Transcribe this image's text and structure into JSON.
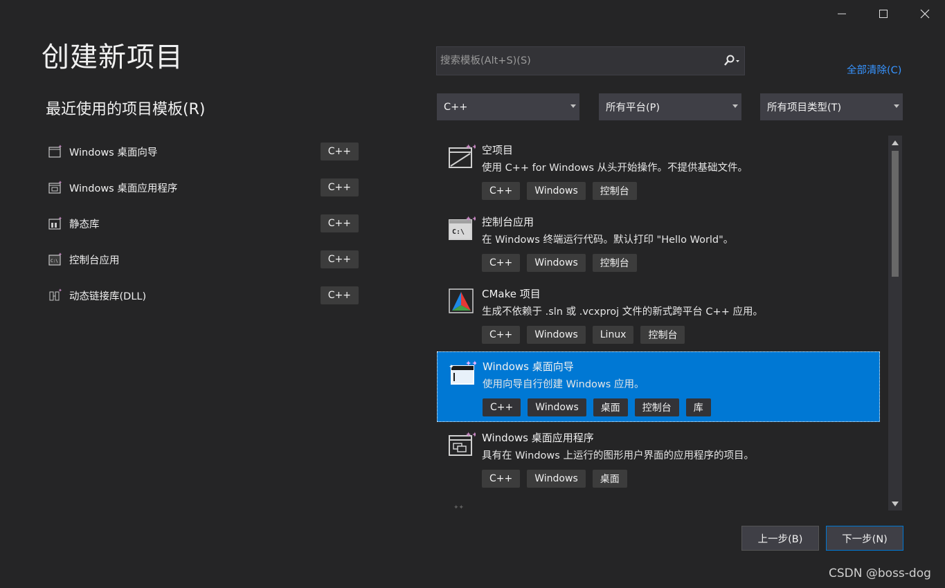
{
  "window_controls": {
    "minimize": "—",
    "maximize": "☐",
    "close": "✕"
  },
  "page": {
    "title": "创建新项目"
  },
  "recent": {
    "title": "最近使用的项目模板(R)",
    "items": [
      {
        "label": "Windows 桌面向导",
        "tag": "C++",
        "icon": "wizard-template-icon"
      },
      {
        "label": "Windows 桌面应用程序",
        "tag": "C++",
        "icon": "desktop-app-template-icon"
      },
      {
        "label": "静态库",
        "tag": "C++",
        "icon": "static-library-template-icon"
      },
      {
        "label": "控制台应用",
        "tag": "C++",
        "icon": "console-app-template-icon"
      },
      {
        "label": "动态链接库(DLL)",
        "tag": "C++",
        "icon": "dll-template-icon"
      }
    ]
  },
  "search": {
    "placeholder": "搜索模板(Alt+S)(S)",
    "value": ""
  },
  "clear_all": "全部清除(C)",
  "filters": {
    "language": "C++",
    "platform": "所有平台(P)",
    "project_type": "所有项目类型(T)"
  },
  "templates": [
    {
      "name": "空项目",
      "desc": "使用 C++ for Windows 从头开始操作。不提供基础文件。",
      "tags": [
        "C++",
        "Windows",
        "控制台"
      ],
      "selected": false,
      "icon": "empty-project-icon"
    },
    {
      "name": "控制台应用",
      "desc": "在 Windows 终端运行代码。默认打印 \"Hello World\"。",
      "tags": [
        "C++",
        "Windows",
        "控制台"
      ],
      "selected": false,
      "icon": "console-app-icon"
    },
    {
      "name": "CMake 项目",
      "desc": "生成不依赖于 .sln 或 .vcxproj 文件的新式跨平台 C++ 应用。",
      "tags": [
        "C++",
        "Windows",
        "Linux",
        "控制台"
      ],
      "selected": false,
      "icon": "cmake-icon"
    },
    {
      "name": "Windows 桌面向导",
      "desc": "使用向导自行创建 Windows 应用。",
      "tags": [
        "C++",
        "Windows",
        "桌面",
        "控制台",
        "库"
      ],
      "selected": true,
      "icon": "desktop-wizard-icon"
    },
    {
      "name": "Windows 桌面应用程序",
      "desc": "具有在 Windows 上运行的图形用户界面的应用程序的项目。",
      "tags": [
        "C++",
        "Windows",
        "桌面"
      ],
      "selected": false,
      "icon": "desktop-application-icon"
    }
  ],
  "buttons": {
    "back": "上一步(B)",
    "next": "下一步(N)"
  },
  "watermark": "CSDN @boss-dog",
  "colors": {
    "background": "#252526",
    "accent": "#0078d4",
    "link": "#3794ff",
    "tag": "#3c3c3c"
  }
}
